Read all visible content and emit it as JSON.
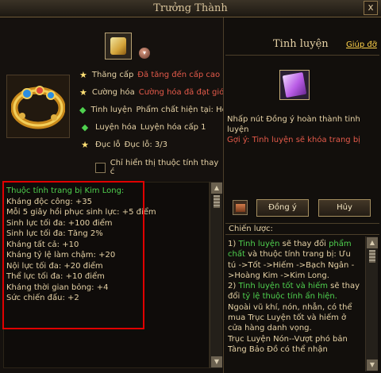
{
  "window": {
    "title": "Trưởng Thành",
    "close_label": "x"
  },
  "left": {
    "rows": [
      {
        "icon": "star-icon",
        "label": "Thăng cấp",
        "value": "Đã tăng đến cấp cao nl",
        "value_color": "red"
      },
      {
        "icon": "star-icon",
        "label": "Cường hóa",
        "value": "Cường hóa đã đạt giớ",
        "value_color": "red"
      },
      {
        "icon": "diamond-icon",
        "label": "Tinh luyện",
        "value": "Phẩm chất hiện tại: Ho.",
        "value_color": "white"
      },
      {
        "icon": "diamond-icon",
        "label": "Luyện hóa",
        "value": "Luyện hóa cấp 1",
        "value_color": "white"
      },
      {
        "icon": "star-icon",
        "label": "Đục lỗ",
        "value": "Đục lỗ: 3/3",
        "value_color": "white"
      }
    ],
    "checkbox_label": "Chỉ hiển thị thuộc tính thay ć",
    "stats_header": "Thuộc tính trang bị Kim Long:",
    "stats": [
      "Kháng độc công: +35",
      "Mỗi 5 giây hồi phục sinh lực: +5 điểm",
      "Sinh lực tối đa: +100 điểm",
      "Sinh lực tối đa: Tăng 2%",
      "Kháng tất cả: +10",
      "Kháng tỷ lệ làm chậm: +20",
      "Nội lực tối đa: +20 điểm",
      "Thể lực tối đa: +10 điểm",
      "Kháng thời gian bỏng: +4",
      "Sức chiến đấu: +2"
    ]
  },
  "right": {
    "title": "Tinh luyện",
    "help_link": "Giúp đỡ",
    "desc": "Nhấp nút Đồng ý hoàn thành tinh luyện",
    "warning": "Gợi ý: Tinh luyện sẽ khóa trang bị",
    "ok_label": "Đồng ý",
    "cancel_label": "Hủy",
    "strategy_header": "Chiến lược:",
    "strategy": {
      "p1a": "1)",
      "p1b": "Tinh luyện",
      "p1c": "sẽ thay đổi",
      "p1d": "phẩm chất",
      "p1e": "và thuộc tính trang bị: Ưu tú ->Tốt ->Hiếm ->Bạch Ngân ->Hoàng Kim ->Kim Long.",
      "p2a": "2)",
      "p2b": "Tinh luyện tốt và hiếm",
      "p2c": "sẽ thay đổi",
      "p2d": "tỷ lệ thuộc tính ẩn hiện.",
      "p2e": "Ngoài vũ khí, nón, nhẫn, có thể mua Trục Luyện tốt và hiếm ở cửa hàng danh vọng.",
      "p3": "Trục Luyện Nón--Vượt phó bản Tàng Bảo Đồ có thể nhận"
    }
  },
  "colors": {
    "accent_gold": "#ffd24a",
    "green": "#4fd14f",
    "red": "#e45a4a",
    "highlight": "#e00000"
  }
}
